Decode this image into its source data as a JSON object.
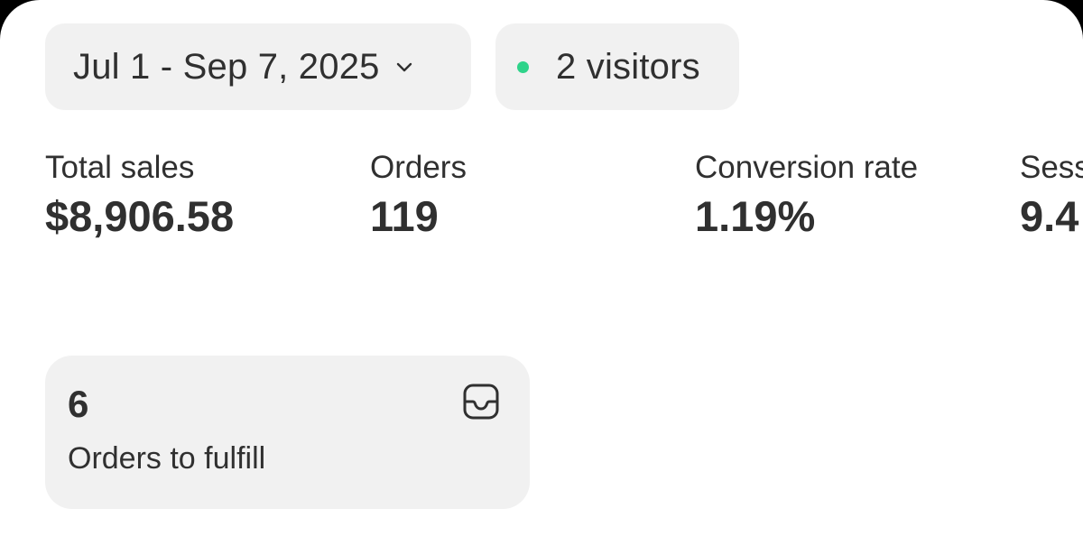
{
  "filters": {
    "date_range": "Jul 1 - Sep 7, 2025",
    "visitors": "2 visitors",
    "visitors_dot_color": "#2fd38a"
  },
  "metrics": [
    {
      "label": "Total sales",
      "value": "$8,906.58"
    },
    {
      "label": "Orders",
      "value": "119"
    },
    {
      "label": "Conversion rate",
      "value": "1.19%"
    },
    {
      "label": "Sess",
      "value": "9.4"
    }
  ],
  "fulfill_card": {
    "count": "6",
    "label": "Orders to fulfill",
    "icon": "inbox-icon"
  }
}
